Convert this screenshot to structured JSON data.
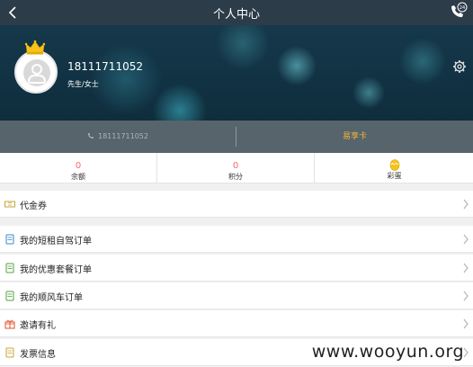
{
  "header": {
    "title": "个人中心",
    "back_icon": "chevron-left-icon",
    "phone_icon": "phone-24-icon",
    "phone_badge": "24"
  },
  "profile": {
    "phone": "18111711052",
    "gender": "先生/女士",
    "avatar_icon": "user-avatar-icon",
    "crown_icon": "crown-icon",
    "settings_icon": "gear-icon"
  },
  "strip": {
    "phone": "18111711052",
    "card": "易享卡"
  },
  "stats": [
    {
      "value": "0",
      "label": "余额"
    },
    {
      "value": "0",
      "label": "积分"
    },
    {
      "value": "",
      "label": "彩蛋"
    }
  ],
  "menu": [
    {
      "label": "代金券",
      "icon": "voucher-icon"
    },
    {
      "label": "我的短租自驾订单",
      "icon": "order-icon"
    },
    {
      "label": "我的优惠套餐订单",
      "icon": "package-icon"
    },
    {
      "label": "我的顺风车订单",
      "icon": "carpool-icon"
    },
    {
      "label": "邀请有礼",
      "icon": "gift-icon"
    },
    {
      "label": "发票信息",
      "icon": "invoice-icon"
    }
  ],
  "watermark": "www.wooyun.org",
  "colors": {
    "header": "#2c3c48",
    "accent": "#f0b43c",
    "stat_value": "#ff6666"
  }
}
